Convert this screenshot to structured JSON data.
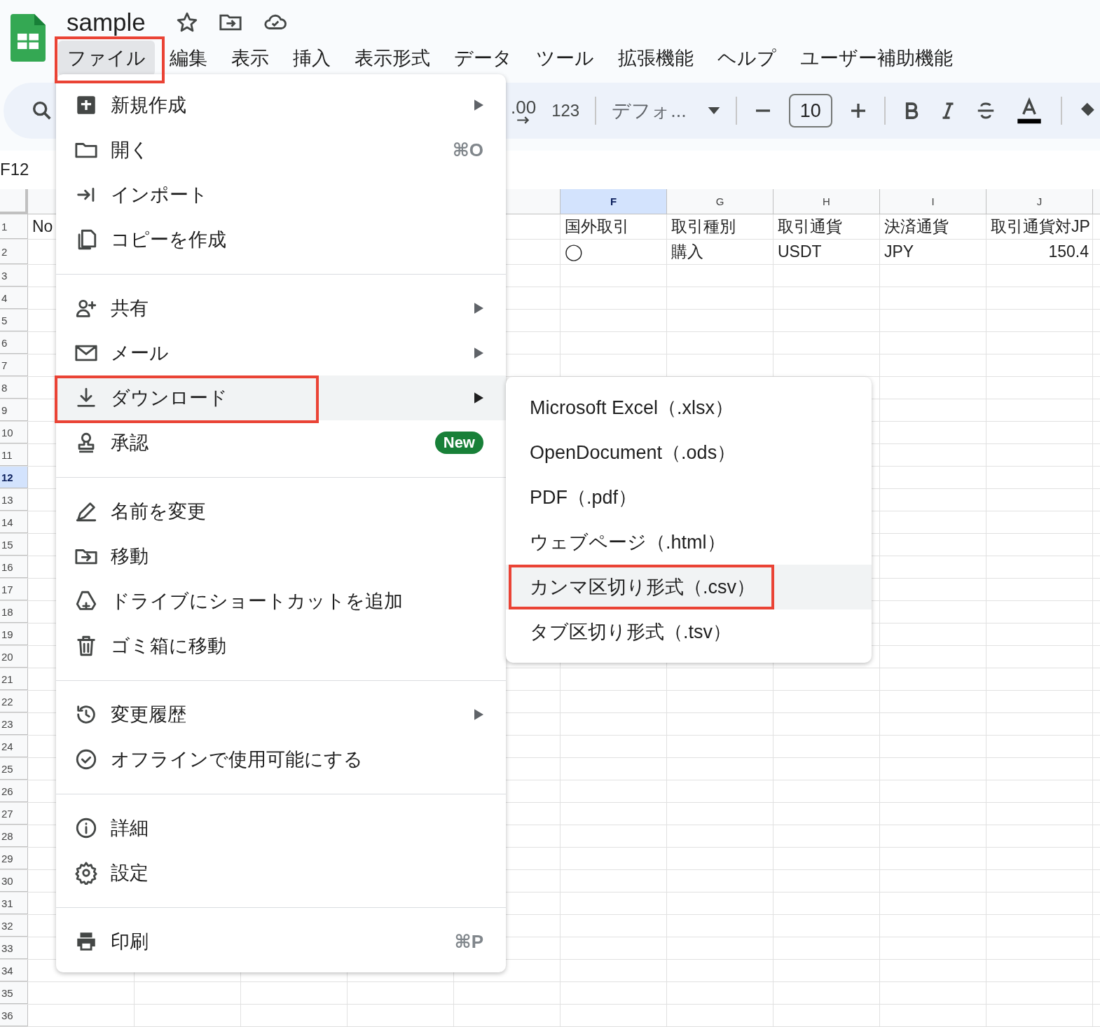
{
  "app": {
    "title": "sample"
  },
  "menubar": [
    {
      "label": "ファイル",
      "selected": true
    },
    {
      "label": "編集",
      "selected": false
    },
    {
      "label": "表示",
      "selected": false
    },
    {
      "label": "挿入",
      "selected": false
    },
    {
      "label": "表示形式",
      "selected": false
    },
    {
      "label": "データ",
      "selected": false
    },
    {
      "label": "ツール",
      "selected": false
    },
    {
      "label": "拡張機能",
      "selected": false
    },
    {
      "label": "ヘルプ",
      "selected": false
    },
    {
      "label": "ユーザー補助機能",
      "selected": false
    }
  ],
  "toolbar": {
    "decimal": ".00",
    "number_format": "123",
    "font": "デフォ...",
    "font_size": "10"
  },
  "name_box": "F12",
  "columns": [
    {
      "label": "F",
      "selected": true
    },
    {
      "label": "G",
      "selected": false
    },
    {
      "label": "H",
      "selected": false
    },
    {
      "label": "I",
      "selected": false
    },
    {
      "label": "J",
      "selected": false
    }
  ],
  "rows": [
    {
      "number": "1",
      "selected": false,
      "cells": {
        "A": {
          "text": "No",
          "kind": "text"
        },
        "F": {
          "text": "国外取引",
          "kind": "text"
        },
        "G": {
          "text": "取引種別",
          "kind": "text"
        },
        "H": {
          "text": "取引通貨",
          "kind": "text"
        },
        "I": {
          "text": "決済通貨",
          "kind": "text"
        },
        "J": {
          "text": "取引通貨対JP",
          "kind": "text"
        }
      }
    },
    {
      "number": "2",
      "selected": false,
      "cells": {
        "F": {
          "text": "◯",
          "kind": "text"
        },
        "G": {
          "text": "購入",
          "kind": "text"
        },
        "H": {
          "text": "USDT",
          "kind": "text"
        },
        "I": {
          "text": "JPY",
          "kind": "text"
        },
        "J": {
          "text": "150.4",
          "kind": "number"
        }
      }
    },
    {
      "number": "3",
      "selected": false
    },
    {
      "number": "4",
      "selected": false
    },
    {
      "number": "5",
      "selected": false
    },
    {
      "number": "6",
      "selected": false
    },
    {
      "number": "7",
      "selected": false
    },
    {
      "number": "8",
      "selected": false
    },
    {
      "number": "9",
      "selected": false
    },
    {
      "number": "10",
      "selected": false
    },
    {
      "number": "11",
      "selected": false
    },
    {
      "number": "12",
      "selected": true
    },
    {
      "number": "13",
      "selected": false
    },
    {
      "number": "14",
      "selected": false
    },
    {
      "number": "15",
      "selected": false
    },
    {
      "number": "16",
      "selected": false
    },
    {
      "number": "17",
      "selected": false
    },
    {
      "number": "18",
      "selected": false
    },
    {
      "number": "19",
      "selected": false
    },
    {
      "number": "20",
      "selected": false
    },
    {
      "number": "21",
      "selected": false
    },
    {
      "number": "22",
      "selected": false
    },
    {
      "number": "23",
      "selected": false
    },
    {
      "number": "24",
      "selected": false
    },
    {
      "number": "25",
      "selected": false
    },
    {
      "number": "26",
      "selected": false
    },
    {
      "number": "27",
      "selected": false
    },
    {
      "number": "28",
      "selected": false
    },
    {
      "number": "29",
      "selected": false
    },
    {
      "number": "30",
      "selected": false
    },
    {
      "number": "31",
      "selected": false
    },
    {
      "number": "32",
      "selected": false
    },
    {
      "number": "33",
      "selected": false
    },
    {
      "number": "34",
      "selected": false
    },
    {
      "number": "35",
      "selected": false
    },
    {
      "number": "36",
      "selected": false
    }
  ],
  "file_menu": {
    "groups": [
      [
        {
          "label": "新規作成",
          "submenu": true,
          "selected": false
        },
        {
          "label": "開く",
          "shortcut": "⌘O",
          "selected": false
        },
        {
          "label": "インポート",
          "selected": false
        },
        {
          "label": "コピーを作成",
          "selected": false
        }
      ],
      [
        {
          "label": "共有",
          "submenu": true,
          "selected": false
        },
        {
          "label": "メール",
          "submenu": true,
          "selected": false
        },
        {
          "label": "ダウンロード",
          "submenu": true,
          "selected": true
        },
        {
          "label": "承認",
          "badge": "New",
          "selected": false
        }
      ],
      [
        {
          "label": "名前を変更",
          "selected": false
        },
        {
          "label": "移動",
          "selected": false
        },
        {
          "label": "ドライブにショートカットを追加",
          "selected": false
        },
        {
          "label": "ゴミ箱に移動",
          "selected": false
        }
      ],
      [
        {
          "label": "変更履歴",
          "submenu": true,
          "selected": false
        },
        {
          "label": "オフラインで使用可能にする",
          "selected": false
        }
      ],
      [
        {
          "label": "詳細",
          "selected": false
        },
        {
          "label": "設定",
          "selected": false
        }
      ],
      [
        {
          "label": "印刷",
          "shortcut": "⌘P",
          "selected": false
        }
      ]
    ]
  },
  "download_submenu": {
    "items": [
      {
        "label": "Microsoft Excel（.xlsx）",
        "selected": false
      },
      {
        "label": "OpenDocument（.ods）",
        "selected": false
      },
      {
        "label": "PDF（.pdf）",
        "selected": false
      },
      {
        "label": "ウェブページ（.html）",
        "selected": false
      },
      {
        "label": "カンマ区切り形式（.csv）",
        "selected": true
      },
      {
        "label": "タブ区切り形式（.tsv）",
        "selected": false
      }
    ]
  }
}
